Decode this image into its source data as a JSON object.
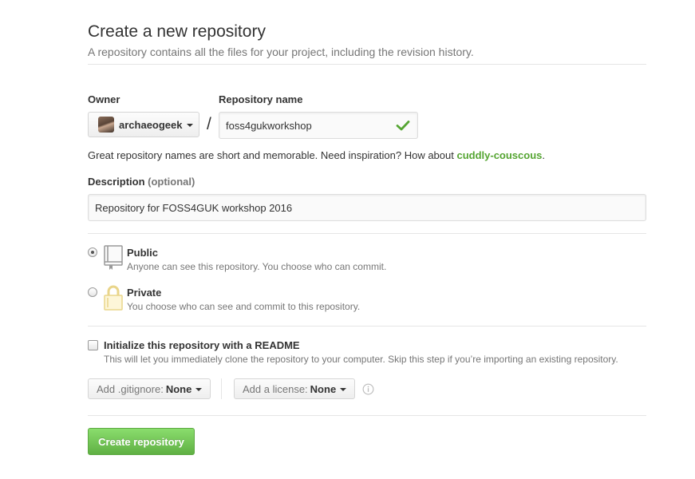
{
  "header": {
    "title": "Create a new repository",
    "subtitle": "A repository contains all the files for your project, including the revision history."
  },
  "form": {
    "owner_label": "Owner",
    "owner_value": "archaeogeek",
    "separator": "/",
    "repo_name_label": "Repository name",
    "repo_name_value": "foss4gukworkshop",
    "hint_prefix": "Great repository names are short and memorable. Need inspiration? How about ",
    "hint_suggestion": "cuddly-couscous",
    "hint_suffix": ".",
    "description_label": "Description",
    "description_optional": "(optional)",
    "description_value": "Repository for FOSS4GUK workshop 2016"
  },
  "visibility": {
    "public_title": "Public",
    "public_note": "Anyone can see this repository. You choose who can commit.",
    "private_title": "Private",
    "private_note": "You choose who can see and commit to this repository.",
    "selected": "public"
  },
  "init": {
    "readme_label": "Initialize this repository with a README",
    "readme_note": "This will let you immediately clone the repository to your computer. Skip this step if you’re importing an existing repository.",
    "gitignore_prefix": "Add .gitignore:",
    "gitignore_value": "None",
    "license_prefix": "Add a license:",
    "license_value": "None"
  },
  "submit": {
    "label": "Create repository"
  },
  "icons": [
    "chevron-down-icon",
    "check-icon",
    "repo-book-icon",
    "lock-icon",
    "info-icon"
  ],
  "colors": {
    "accent_green": "#55a532",
    "button_green": "#60b044",
    "muted_text": "#767676",
    "lock_yellow": "#e9d58a"
  }
}
